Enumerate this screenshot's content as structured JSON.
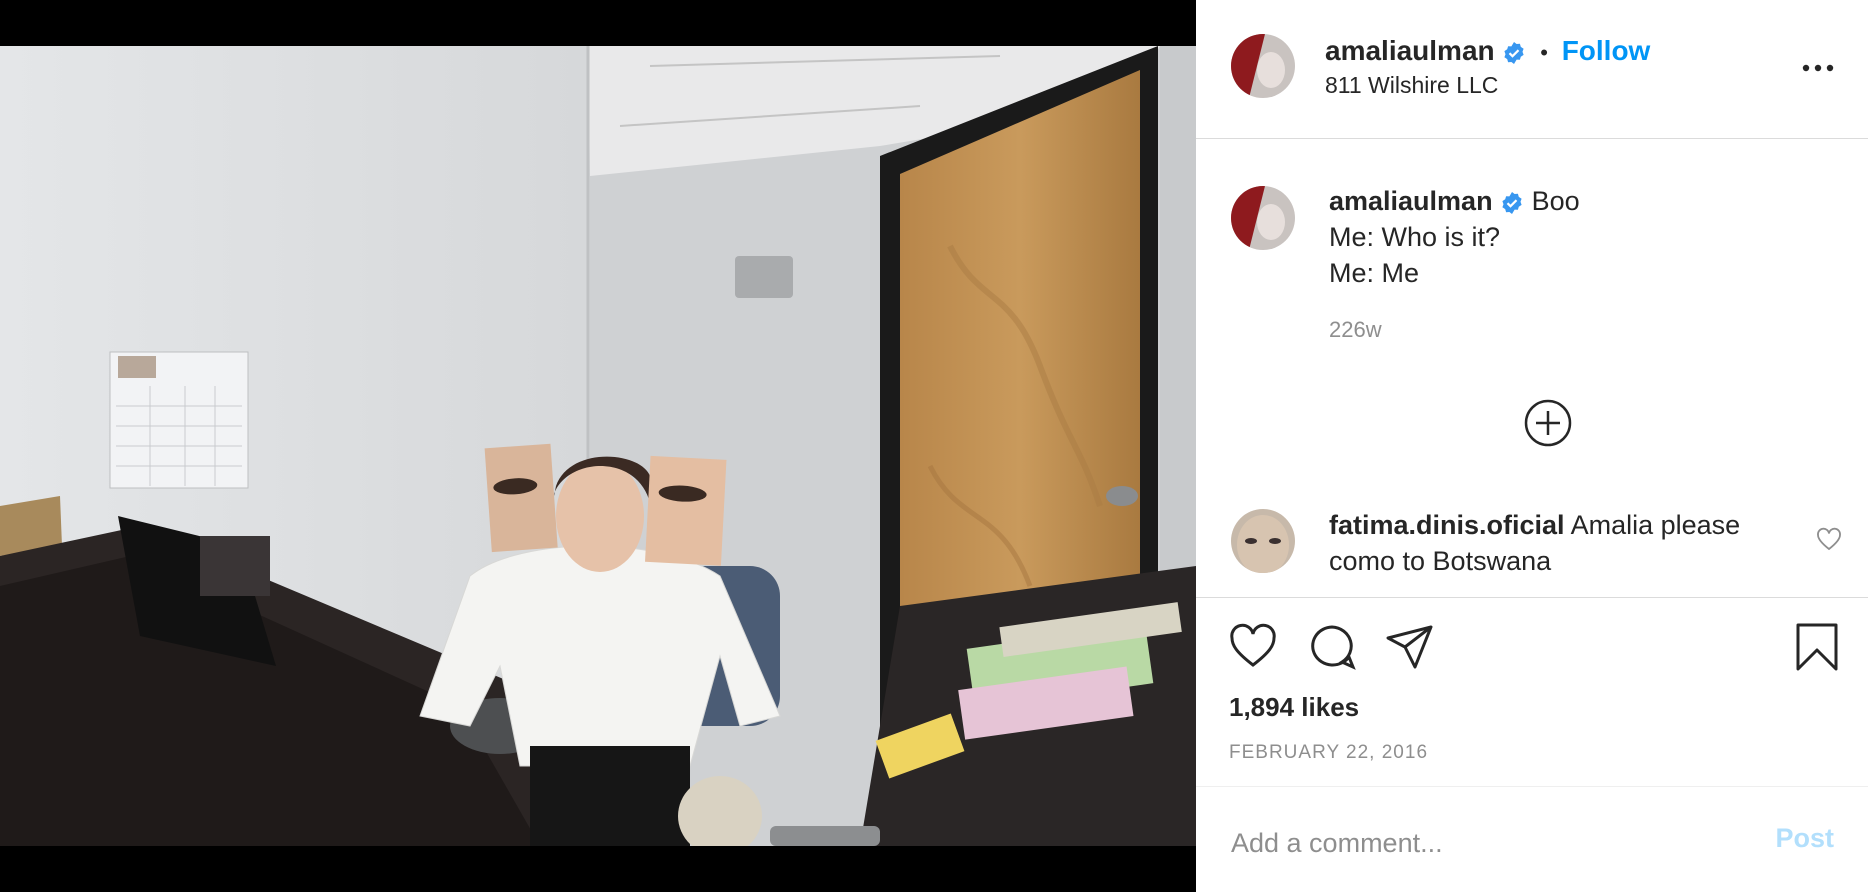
{
  "post": {
    "author": "amaliaulman",
    "follow_label": "Follow",
    "separator": "•",
    "location": "811 Wilshire LLC",
    "more_icon": "more-horizontal-icon",
    "caption": {
      "username": "amaliaulman",
      "first_line": "Boo",
      "line2": "Me: Who is it?",
      "line3": "Me: Me",
      "time": "226w"
    },
    "comments": [
      {
        "username": "fatima.dinis.oficial",
        "text": "Amalia please como to Botswana"
      }
    ],
    "likes": "1,894 likes",
    "date": "FEBRUARY 22, 2016",
    "comment_placeholder": "Add a comment...",
    "post_label": "Post"
  },
  "colors": {
    "accent": "#0095f6",
    "verified": "#3897f0",
    "post_disabled": "#b2dffc",
    "muted": "#8e8e8e"
  }
}
